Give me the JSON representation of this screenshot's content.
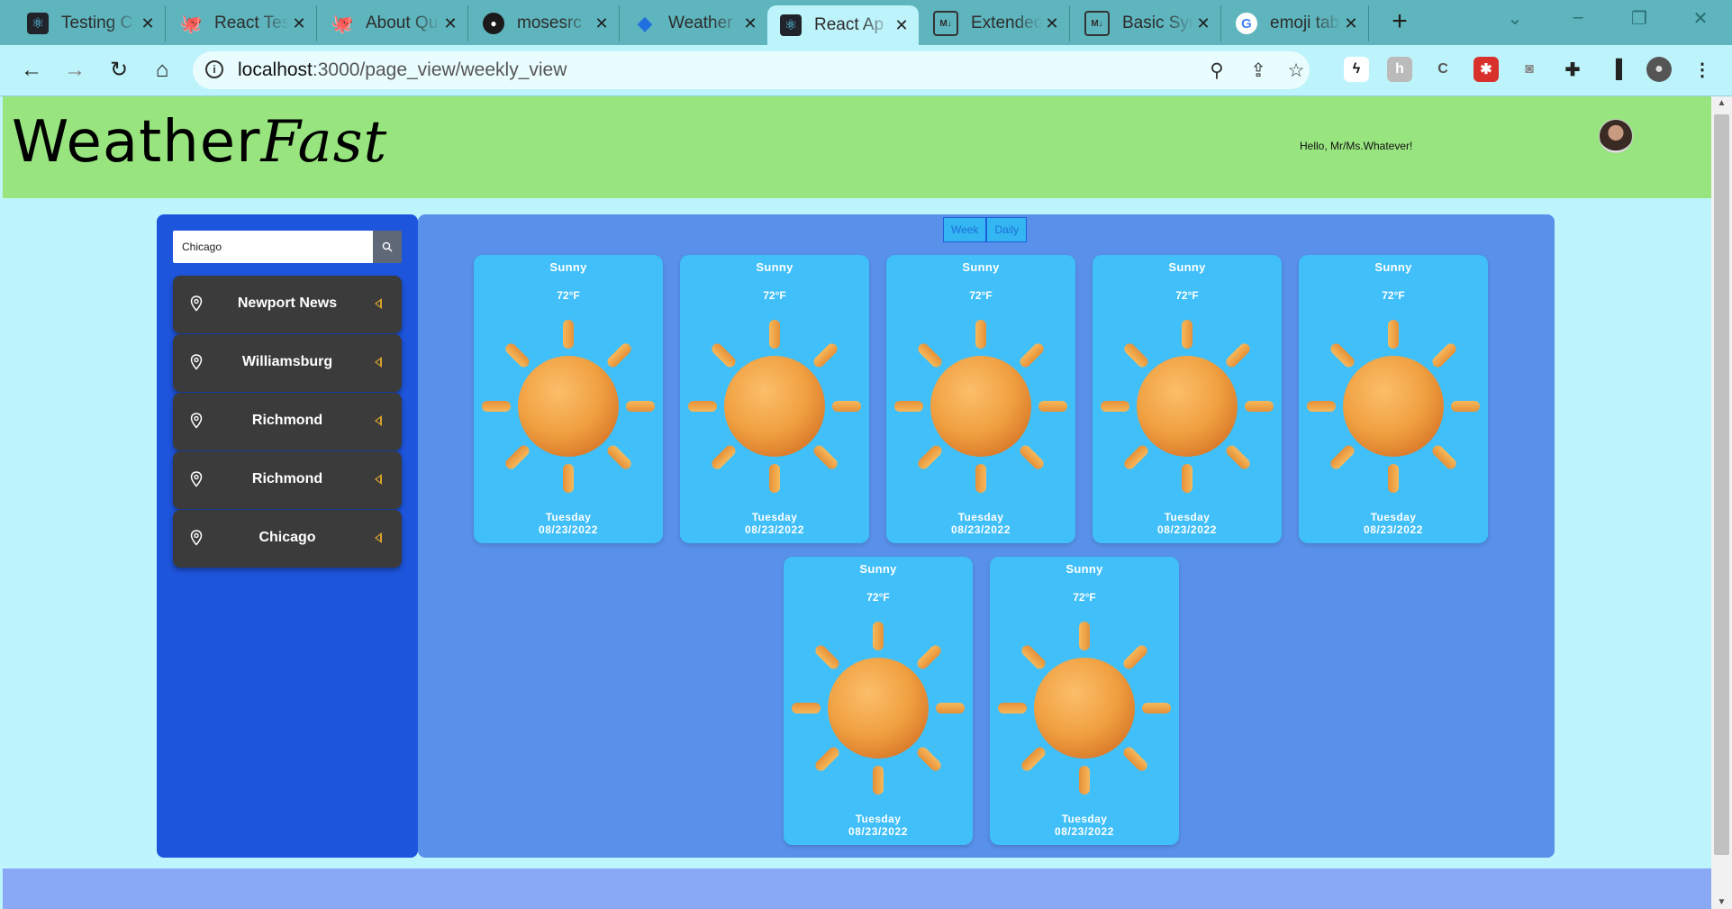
{
  "browser": {
    "tabs": [
      {
        "title": "Testing C",
        "icon": "react-icon"
      },
      {
        "title": "React Tes",
        "icon": "octopus-icon"
      },
      {
        "title": "About Qu",
        "icon": "octopus-icon"
      },
      {
        "title": "mosesrc",
        "icon": "github-icon"
      },
      {
        "title": "Weather",
        "icon": "jira-icon"
      },
      {
        "title": "React Ap",
        "icon": "react-icon"
      },
      {
        "title": "Extended",
        "icon": "markdown-icon"
      },
      {
        "title": "Basic Syn",
        "icon": "markdown-icon"
      },
      {
        "title": "emoji tab",
        "icon": "google-icon"
      }
    ],
    "address": {
      "host": "localhost",
      "path": ":3000/page_view/weekly_view"
    }
  },
  "app": {
    "brand_part1": "Weather",
    "brand_part2": "Fast",
    "greeting": "Hello, Mr/Ms.Whatever!"
  },
  "sidebar": {
    "search_value": "Chicago",
    "locations": [
      "Newport News",
      "Williamsburg",
      "Richmond",
      "Richmond",
      "Chicago"
    ]
  },
  "view_toggle": {
    "week": "Week",
    "daily": "Daily"
  },
  "forecast": [
    {
      "condition": "Sunny",
      "temp": "72°F",
      "day": "Tuesday",
      "date": "08/23/2022"
    },
    {
      "condition": "Sunny",
      "temp": "72°F",
      "day": "Tuesday",
      "date": "08/23/2022"
    },
    {
      "condition": "Sunny",
      "temp": "72°F",
      "day": "Tuesday",
      "date": "08/23/2022"
    },
    {
      "condition": "Sunny",
      "temp": "72°F",
      "day": "Tuesday",
      "date": "08/23/2022"
    },
    {
      "condition": "Sunny",
      "temp": "72°F",
      "day": "Tuesday",
      "date": "08/23/2022"
    },
    {
      "condition": "Sunny",
      "temp": "72°F",
      "day": "Tuesday",
      "date": "08/23/2022"
    },
    {
      "condition": "Sunny",
      "temp": "72°F",
      "day": "Tuesday",
      "date": "08/23/2022"
    }
  ],
  "colors": {
    "header": "#98e47f",
    "sidebar": "#1e55dd",
    "panel": "#5890ea",
    "card": "#40bff9",
    "location_item": "#3b3b3b",
    "page": "#bef5fd"
  }
}
